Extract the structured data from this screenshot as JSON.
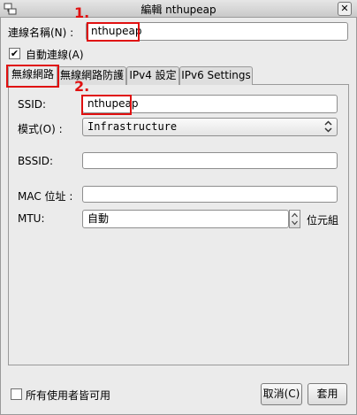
{
  "window": {
    "title": "編輯 nthupeap",
    "close_glyph": "✕",
    "icon": "network-connection-icon"
  },
  "connection_name": {
    "label": "連線名稱(N) :",
    "value": "nthupeap"
  },
  "auto_connect": {
    "label": "自動連線(A)",
    "checked": true,
    "check_glyph": "✔"
  },
  "tabs": [
    {
      "label": "無線網路",
      "active": true
    },
    {
      "label": "無線網路防護",
      "active": false
    },
    {
      "label": "IPv4 設定",
      "active": false
    },
    {
      "label": "IPv6 Settings",
      "active": false
    }
  ],
  "wireless": {
    "ssid_label": "SSID:",
    "ssid_value": "nthupeap",
    "mode_label": "模式(O) :",
    "mode_value": "Infrastructure",
    "bssid_label": "BSSID:",
    "bssid_value": "",
    "mac_label": "MAC 位址 :",
    "mac_value": "",
    "mtu_label": "MTU:",
    "mtu_value": "自動",
    "mtu_unit": "位元組"
  },
  "all_users": {
    "label": "所有使用者皆可用",
    "checked": false
  },
  "buttons": {
    "cancel": "取消(C)",
    "apply": "套用"
  },
  "annotations": {
    "step1": "1.",
    "step2": "2."
  },
  "colors": {
    "annotation_red": "#e01010",
    "window_bg": "#ebebeb"
  }
}
